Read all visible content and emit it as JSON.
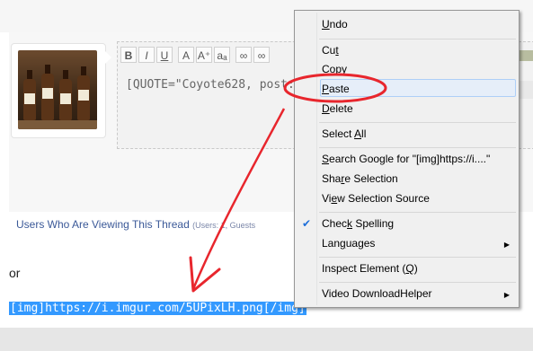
{
  "editor": {
    "toolbar": [
      {
        "label": "B",
        "icon": "bold-icon"
      },
      {
        "label": "I",
        "icon": "italic-icon"
      },
      {
        "label": "U",
        "icon": "underline-icon"
      },
      {
        "label": "A",
        "icon": "text-color-icon"
      },
      {
        "label": "A⁺",
        "icon": "font-size-icon"
      },
      {
        "label": "aₐ",
        "icon": "font-family-icon"
      },
      {
        "label": "∞",
        "icon": "link-icon"
      },
      {
        "label": "∞",
        "icon": "unlink-icon"
      }
    ],
    "quote_text": "[QUOTE=\"Coyote628, post: 202"
  },
  "viewing_thread": {
    "text": "Users Who Are Viewing This Thread",
    "detail": "(Users: 1, Guests"
  },
  "reply": {
    "or_text": "or",
    "selected_text": "[img]https://i.imgur.com/5UPixLH.png[/img]"
  },
  "context_menu": {
    "items": [
      {
        "label": "Undo",
        "access_key": "U"
      },
      {
        "label": "Cut",
        "access_key": "t"
      },
      {
        "label": "Copy",
        "access_key": "C"
      },
      {
        "label": "Paste",
        "access_key": "P"
      },
      {
        "label": "Delete",
        "access_key": "D"
      },
      {
        "label": "Select All",
        "access_key": "A"
      },
      {
        "label": "Search Google for \"[img]https://i....\"",
        "access_key": "S"
      },
      {
        "label": "Share Selection",
        "access_key": "r"
      },
      {
        "label": "View Selection Source",
        "access_key": "e"
      },
      {
        "label": "Check Spelling",
        "access_key": "k"
      },
      {
        "label": "Languages",
        "access_key": "g"
      },
      {
        "label": "Inspect Element (Q)",
        "access_key": "Q"
      },
      {
        "label": "Video DownloadHelper",
        "access_key": ""
      }
    ],
    "highlighted": "Paste",
    "checked": "Check Spelling"
  },
  "colors": {
    "selection": "#3399ff",
    "annotation": "#e8262d",
    "menu_bg": "#f0f0f0",
    "link": "#3b5998"
  }
}
